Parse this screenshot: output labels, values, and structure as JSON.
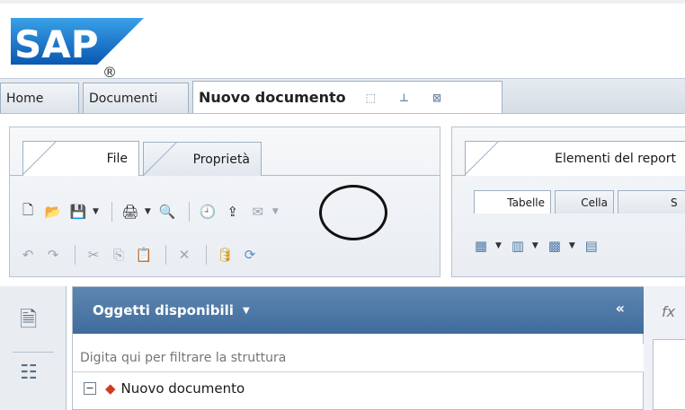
{
  "logo": {
    "text": "SAP",
    "registered": "®"
  },
  "tabs": [
    {
      "label": "Home"
    },
    {
      "label": "Documenti"
    },
    {
      "label": "Nuovo documento"
    }
  ],
  "left_panel": {
    "tabs": [
      {
        "label": "File"
      },
      {
        "label": "Proprietà"
      }
    ]
  },
  "right_panel": {
    "tabs": [
      {
        "label": "Elementi del report"
      }
    ],
    "subtabs": [
      {
        "label": "Tabelle"
      },
      {
        "label": "Cella"
      },
      {
        "label": "S"
      }
    ]
  },
  "objects_panel": {
    "title": "Oggetti disponibili",
    "filter_placeholder": "Digita qui per filtrare la struttura",
    "tree_item": "Nuovo documento"
  },
  "formula_label": "fx",
  "colors": {
    "header_blue": "#4a76a6",
    "tab_border": "#9fb0c3"
  }
}
